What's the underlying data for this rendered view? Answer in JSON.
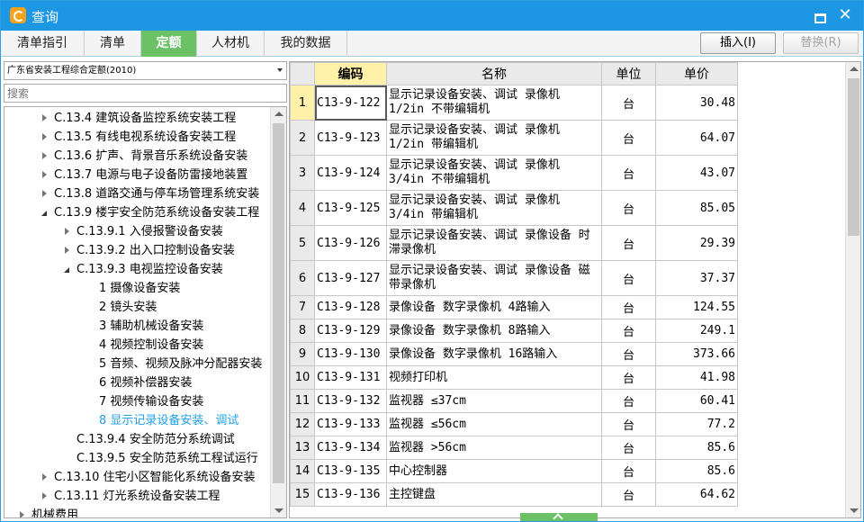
{
  "window": {
    "title": "查询",
    "colors": {
      "titlebar": "#1d97e4",
      "active_tab": "#6cc166",
      "selected_node": "#1ea0e9",
      "highlight": "#fff1a8"
    }
  },
  "tabs": [
    {
      "label": "清单指引",
      "active": false
    },
    {
      "label": "清单",
      "active": false
    },
    {
      "label": "定额",
      "active": true
    },
    {
      "label": "人材机",
      "active": false
    },
    {
      "label": "我的数据",
      "active": false
    }
  ],
  "toolbar": {
    "insert_label": "插入(I)",
    "replace_label": "替换(R)"
  },
  "left": {
    "quota_select": "广东省安装工程综合定额(2010)",
    "search_placeholder": "搜索"
  },
  "tree": [
    {
      "label": "C.13.4 建筑设备监控系统安装工程",
      "state": "closed",
      "selected": false
    },
    {
      "label": "C.13.5 有线电视系统设备安装工程",
      "state": "closed",
      "selected": false
    },
    {
      "label": "C.13.6 扩声、背景音乐系统设备安装",
      "state": "closed",
      "selected": false
    },
    {
      "label": "C.13.7 电源与电子设备防雷接地装置",
      "state": "closed",
      "selected": false
    },
    {
      "label": "C.13.8 道路交通与停车场管理系统安装",
      "state": "closed",
      "selected": false
    },
    {
      "label": "C.13.9 楼宇安全防范系统设备安装工程",
      "state": "open",
      "selected": false
    },
    {
      "label": "C.13.9.1 入侵报警设备安装",
      "state": "closed",
      "selected": false
    },
    {
      "label": "C.13.9.2 出入口控制设备安装",
      "state": "closed",
      "selected": false
    },
    {
      "label": "C.13.9.3 电视监控设备安装",
      "state": "open",
      "selected": false
    },
    {
      "label": "1 摄像设备安装",
      "state": "none",
      "selected": false
    },
    {
      "label": "2 镜头安装",
      "state": "none",
      "selected": false
    },
    {
      "label": "3 辅助机械设备安装",
      "state": "none",
      "selected": false
    },
    {
      "label": "4 视频控制设备安装",
      "state": "none",
      "selected": false
    },
    {
      "label": "5 音频、视频及脉冲分配器安装",
      "state": "none",
      "selected": false
    },
    {
      "label": "6 视频补偿器安装",
      "state": "none",
      "selected": false
    },
    {
      "label": "7 视频传输设备安装",
      "state": "none",
      "selected": false
    },
    {
      "label": "8 显示记录设备安装、调试",
      "state": "none",
      "selected": true
    },
    {
      "label": "C.13.9.4 安全防范分系统调试",
      "state": "none",
      "selected": false
    },
    {
      "label": "C.13.9.5 安全防范系统工程试运行",
      "state": "none",
      "selected": false
    },
    {
      "label": "C.13.10 住宅小区智能化系统设备安装",
      "state": "closed",
      "selected": false
    },
    {
      "label": "C.13.11 灯光系统设备安装工程",
      "state": "closed",
      "selected": false
    },
    {
      "label": "机械费用",
      "state": "closed",
      "selected": false
    }
  ],
  "grid": {
    "headers": {
      "code": "编码",
      "name": "名称",
      "unit": "单位",
      "price": "单价"
    },
    "rows": [
      {
        "no": "1",
        "code": "C13-9-122",
        "name": "显示记录设备安装、调试 录像机 1/2in 不带编辑机",
        "unit": "台",
        "price": "30.48"
      },
      {
        "no": "2",
        "code": "C13-9-123",
        "name": "显示记录设备安装、调试 录像机 1/2in 带编辑机",
        "unit": "台",
        "price": "64.07"
      },
      {
        "no": "3",
        "code": "C13-9-124",
        "name": "显示记录设备安装、调试 录像机 3/4in 不带编辑机",
        "unit": "台",
        "price": "43.07"
      },
      {
        "no": "4",
        "code": "C13-9-125",
        "name": "显示记录设备安装、调试 录像机 3/4in 带编辑机",
        "unit": "台",
        "price": "85.05"
      },
      {
        "no": "5",
        "code": "C13-9-126",
        "name": "显示记录设备安装、调试 录像设备 时滞录像机",
        "unit": "台",
        "price": "29.39"
      },
      {
        "no": "6",
        "code": "C13-9-127",
        "name": "显示记录设备安装、调试 录像设备 磁带录像机",
        "unit": "台",
        "price": "37.37"
      },
      {
        "no": "7",
        "code": "C13-9-128",
        "name": "录像设备 数字录像机 4路输入",
        "unit": "台",
        "price": "124.55"
      },
      {
        "no": "8",
        "code": "C13-9-129",
        "name": "录像设备 数字录像机 8路输入",
        "unit": "台",
        "price": "249.1"
      },
      {
        "no": "9",
        "code": "C13-9-130",
        "name": "录像设备 数字录像机 16路输入",
        "unit": "台",
        "price": "373.66"
      },
      {
        "no": "10",
        "code": "C13-9-131",
        "name": "视频打印机",
        "unit": "台",
        "price": "41.98"
      },
      {
        "no": "11",
        "code": "C13-9-132",
        "name": "监视器 ≤37cm",
        "unit": "台",
        "price": "60.41"
      },
      {
        "no": "12",
        "code": "C13-9-133",
        "name": "监视器 ≤56cm",
        "unit": "台",
        "price": "77.2"
      },
      {
        "no": "13",
        "code": "C13-9-134",
        "name": "监视器 >56cm",
        "unit": "台",
        "price": "85.6"
      },
      {
        "no": "14",
        "code": "C13-9-135",
        "name": "中心控制器",
        "unit": "台",
        "price": "85.6"
      },
      {
        "no": "15",
        "code": "C13-9-136",
        "name": "主控键盘",
        "unit": "台",
        "price": "64.62"
      }
    ]
  }
}
